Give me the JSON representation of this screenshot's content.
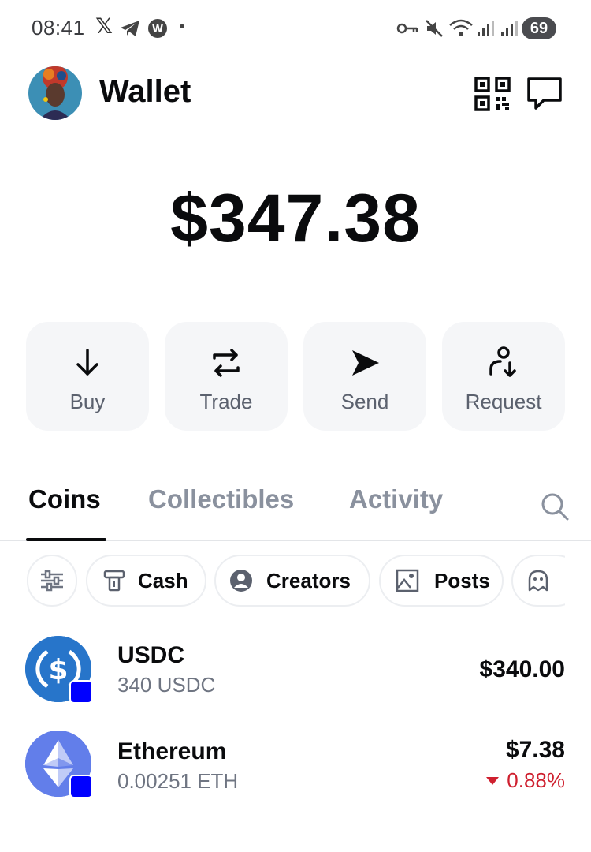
{
  "status_bar": {
    "time": "08:41",
    "battery": "69",
    "icons": [
      "x-icon",
      "telegram-icon",
      "app-notification-icon",
      "dot-icon",
      "key-icon",
      "mute-icon",
      "wifi-icon",
      "signal-icon",
      "signal-icon"
    ]
  },
  "header": {
    "title": "Wallet"
  },
  "balance": "$347.38",
  "actions": [
    {
      "label": "Buy",
      "icon": "arrow-down-icon"
    },
    {
      "label": "Trade",
      "icon": "swap-icon"
    },
    {
      "label": "Send",
      "icon": "send-icon"
    },
    {
      "label": "Request",
      "icon": "request-icon"
    }
  ],
  "tabs": [
    {
      "label": "Coins",
      "active": true
    },
    {
      "label": "Collectibles",
      "active": false
    },
    {
      "label": "Activity",
      "active": false
    }
  ],
  "filters": [
    {
      "label": "",
      "icon": "sliders-icon"
    },
    {
      "label": "Cash",
      "icon": "cash-icon"
    },
    {
      "label": "Creators",
      "icon": "creator-icon"
    },
    {
      "label": "Posts",
      "icon": "image-icon"
    },
    {
      "label": "",
      "icon": "ghost-icon"
    }
  ],
  "coins": [
    {
      "name": "USDC",
      "amount": "340 USDC",
      "value": "$340.00",
      "change": "",
      "color": "#2775ca"
    },
    {
      "name": "Ethereum",
      "amount": "0.00251 ETH",
      "value": "$7.38",
      "change": "0.88%",
      "change_direction": "down",
      "color": "#627eea"
    }
  ],
  "colors": {
    "accent_badge": "#0000ff",
    "negative": "#cf202f",
    "muted_text": "#8a919e"
  }
}
